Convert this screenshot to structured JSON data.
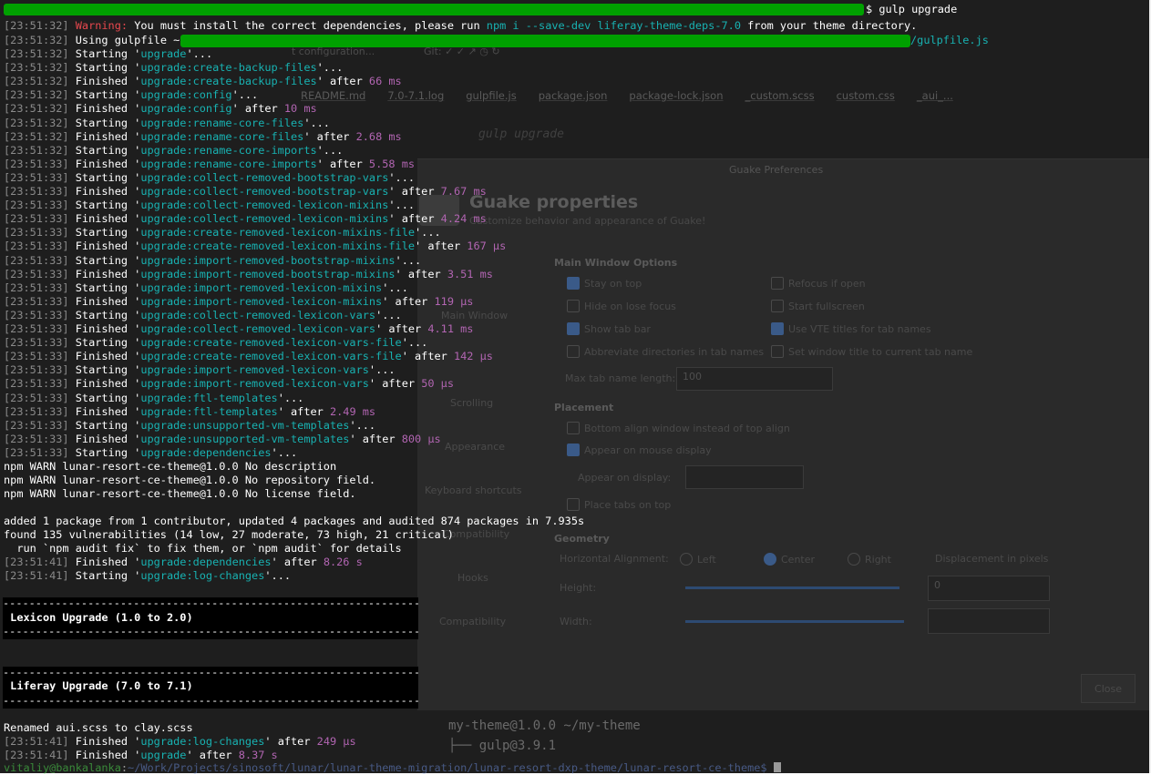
{
  "background_window": {
    "toolbar_left": "t configuration...",
    "toolbar_right": "Git: ✓ ✓ ↗ ◷ ↻",
    "tabs": [
      "README.md",
      "7.0-7.1.log",
      "gulpfile.js",
      "package.json",
      "package-lock.json",
      "_custom.scss",
      "custom.css",
      "_aui_..."
    ],
    "editor_text": "gulp upgrade",
    "dialog_title": "Guake Preferences",
    "heading": "Guake properties",
    "subheading": "Customize behavior and appearance of Guake!",
    "sidebar": [
      "Main Window",
      "Scrolling",
      "Appearance",
      "Keyboard shortcuts",
      "Compatibility",
      "Hooks",
      "Compatibility"
    ],
    "sections": {
      "main": "Main Window Options",
      "placement": "Placement",
      "geometry": "Geometry"
    },
    "options": [
      {
        "label": "Stay on top",
        "checked": true
      },
      {
        "label": "Refocus if open",
        "checked": false
      },
      {
        "label": "Hide on lose focus",
        "checked": false
      },
      {
        "label": "Start fullscreen",
        "checked": false
      },
      {
        "label": "Show tab bar",
        "checked": true
      },
      {
        "label": "Use VTE titles for tab names",
        "checked": true
      },
      {
        "label": "Abbreviate directories in tab names",
        "checked": false
      },
      {
        "label": "Set window title to current tab name",
        "checked": false
      }
    ],
    "max_tab_label": "Max tab name length:",
    "max_tab_value": "100",
    "placement_options": [
      {
        "label": "Bottom align window instead of top align",
        "checked": false
      },
      {
        "label": "Appear on mouse display",
        "checked": true
      }
    ],
    "appear_on_display_label": "Appear on display:",
    "place_tabs": "Place tabs on top",
    "horizontal_alignment": "Horizontal Alignment:",
    "align_options": [
      "Left",
      "Center",
      "Right"
    ],
    "displacement": "Displacement in pixels",
    "displacement_value": "0",
    "height_label": "Height:",
    "width_label": "Width:",
    "close_button": "Close",
    "lower_line1": "my-theme@1.0.0 ~/my-theme",
    "lower_line2": "├── gulp@3.9.1"
  },
  "terminal": {
    "prompt_command": "$ gulp upgrade",
    "warning_ts": "[23:51:32]",
    "warning_label": "Warning:",
    "warning_pre": " You must install the correct dependencies, please run ",
    "warning_cmd": "npm i --save-dev liferay-theme-deps-7.0",
    "warning_post": " from your theme directory.",
    "gulpfile_ts": "[23:51:32]",
    "gulpfile_pre": " Using gulpfile ~",
    "gulpfile_post": "/gulpfile.js",
    "task_lines": [
      {
        "ts": "[23:51:32]",
        "verb": "Starting",
        "task": "upgrade",
        "after": ""
      },
      {
        "ts": "[23:51:32]",
        "verb": "Starting",
        "task": "upgrade:create-backup-files",
        "after": ""
      },
      {
        "ts": "[23:51:32]",
        "verb": "Finished",
        "task": "upgrade:create-backup-files",
        "after": "66 ms"
      },
      {
        "ts": "[23:51:32]",
        "verb": "Starting",
        "task": "upgrade:config",
        "after": ""
      },
      {
        "ts": "[23:51:32]",
        "verb": "Finished",
        "task": "upgrade:config",
        "after": "10 ms"
      },
      {
        "ts": "[23:51:32]",
        "verb": "Starting",
        "task": "upgrade:rename-core-files",
        "after": ""
      },
      {
        "ts": "[23:51:32]",
        "verb": "Finished",
        "task": "upgrade:rename-core-files",
        "after": "2.68 ms"
      },
      {
        "ts": "[23:51:32]",
        "verb": "Starting",
        "task": "upgrade:rename-core-imports",
        "after": ""
      },
      {
        "ts": "[23:51:33]",
        "verb": "Finished",
        "task": "upgrade:rename-core-imports",
        "after": "5.58 ms"
      },
      {
        "ts": "[23:51:33]",
        "verb": "Starting",
        "task": "upgrade:collect-removed-bootstrap-vars",
        "after": ""
      },
      {
        "ts": "[23:51:33]",
        "verb": "Finished",
        "task": "upgrade:collect-removed-bootstrap-vars",
        "after": "7.67 ms"
      },
      {
        "ts": "[23:51:33]",
        "verb": "Starting",
        "task": "upgrade:collect-removed-lexicon-mixins",
        "after": ""
      },
      {
        "ts": "[23:51:33]",
        "verb": "Finished",
        "task": "upgrade:collect-removed-lexicon-mixins",
        "after": "4.24 ms"
      },
      {
        "ts": "[23:51:33]",
        "verb": "Starting",
        "task": "upgrade:create-removed-lexicon-mixins-file",
        "after": ""
      },
      {
        "ts": "[23:51:33]",
        "verb": "Finished",
        "task": "upgrade:create-removed-lexicon-mixins-file",
        "after": "167 μs"
      },
      {
        "ts": "[23:51:33]",
        "verb": "Starting",
        "task": "upgrade:import-removed-bootstrap-mixins",
        "after": ""
      },
      {
        "ts": "[23:51:33]",
        "verb": "Finished",
        "task": "upgrade:import-removed-bootstrap-mixins",
        "after": "3.51 ms"
      },
      {
        "ts": "[23:51:33]",
        "verb": "Starting",
        "task": "upgrade:import-removed-lexicon-mixins",
        "after": ""
      },
      {
        "ts": "[23:51:33]",
        "verb": "Finished",
        "task": "upgrade:import-removed-lexicon-mixins",
        "after": "119 μs"
      },
      {
        "ts": "[23:51:33]",
        "verb": "Starting",
        "task": "upgrade:collect-removed-lexicon-vars",
        "after": ""
      },
      {
        "ts": "[23:51:33]",
        "verb": "Finished",
        "task": "upgrade:collect-removed-lexicon-vars",
        "after": "4.11 ms"
      },
      {
        "ts": "[23:51:33]",
        "verb": "Starting",
        "task": "upgrade:create-removed-lexicon-vars-file",
        "after": ""
      },
      {
        "ts": "[23:51:33]",
        "verb": "Finished",
        "task": "upgrade:create-removed-lexicon-vars-file",
        "after": "142 μs"
      },
      {
        "ts": "[23:51:33]",
        "verb": "Starting",
        "task": "upgrade:import-removed-lexicon-vars",
        "after": ""
      },
      {
        "ts": "[23:51:33]",
        "verb": "Finished",
        "task": "upgrade:import-removed-lexicon-vars",
        "after": "50 μs"
      },
      {
        "ts": "[23:51:33]",
        "verb": "Starting",
        "task": "upgrade:ftl-templates",
        "after": ""
      },
      {
        "ts": "[23:51:33]",
        "verb": "Finished",
        "task": "upgrade:ftl-templates",
        "after": "2.49 ms"
      },
      {
        "ts": "[23:51:33]",
        "verb": "Starting",
        "task": "upgrade:unsupported-vm-templates",
        "after": ""
      },
      {
        "ts": "[23:51:33]",
        "verb": "Finished",
        "task": "upgrade:unsupported-vm-templates",
        "after": "800 μs"
      },
      {
        "ts": "[23:51:33]",
        "verb": "Starting",
        "task": "upgrade:dependencies",
        "after": ""
      }
    ],
    "npm_lines": [
      "npm WARN lunar-resort-ce-theme@1.0.0 No description",
      "npm WARN lunar-resort-ce-theme@1.0.0 No repository field.",
      "npm WARN lunar-resort-ce-theme@1.0.0 No license field."
    ],
    "added_line": "added 1 package from 1 contributor, updated 4 packages and audited 874 packages in 7.935s",
    "found_line": "found 135 vulnerabilities (14 low, 27 moderate, 73 high, 21 critical)",
    "run_line": "  run `npm audit fix` to fix them, or `npm audit` for details",
    "task_lines_2": [
      {
        "ts": "[23:51:41]",
        "verb": "Finished",
        "task": "upgrade:dependencies",
        "after": "8.26 s"
      },
      {
        "ts": "[23:51:41]",
        "verb": "Starting",
        "task": "upgrade:log-changes",
        "after": ""
      }
    ],
    "rule": "----------------------------------------------------------------",
    "lexicon_header": " Lexicon Upgrade (1.0 to 2.0)",
    "liferay_header": " Liferay Upgrade (7.0 to 7.1)",
    "renamed_line": "Renamed aui.scss to clay.scss",
    "task_lines_3": [
      {
        "ts": "[23:51:41]",
        "verb": "Finished",
        "task": "upgrade:log-changes",
        "after": "249 μs"
      },
      {
        "ts": "[23:51:41]",
        "verb": "Finished",
        "task": "upgrade",
        "after": "8.37 s"
      }
    ],
    "bottom_prompt_user": "vitaliy@bankalanka",
    "bottom_prompt_path": "~/Work/Projects/sinosoft/lunar/lunar-theme-migration/lunar-resort-dxp-theme/lunar-resort-ce-theme$",
    "colors": {
      "timestamp": "#8a8a8a",
      "task": "#18b2b2",
      "duration": "#b265b2",
      "warning": "#e8484e",
      "redaction": "#00a000"
    }
  }
}
